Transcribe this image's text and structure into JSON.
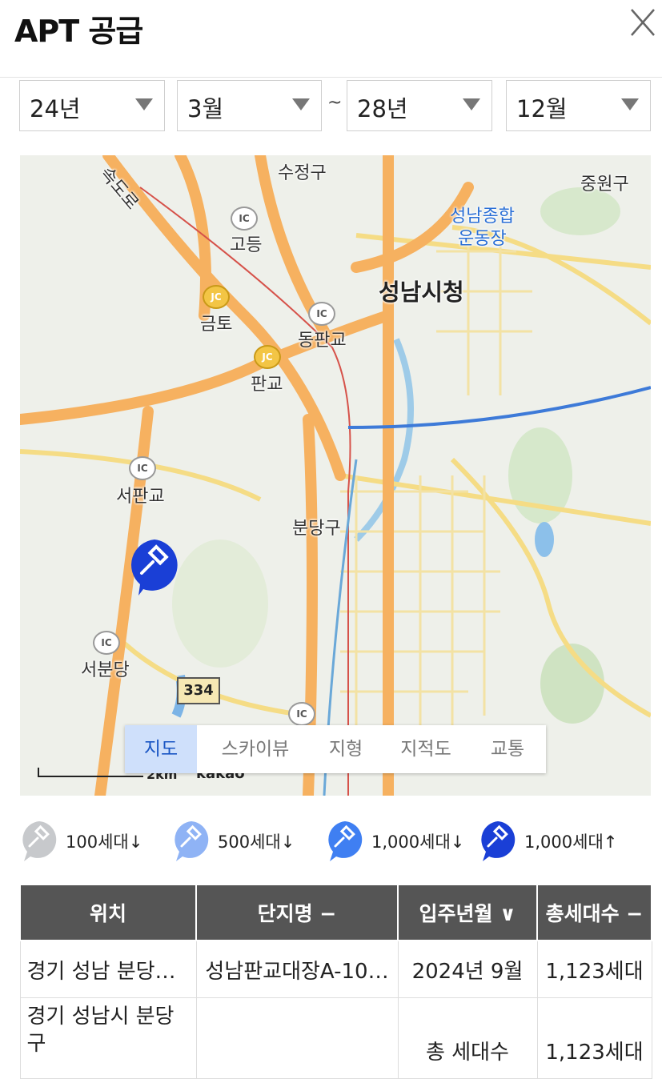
{
  "header": {
    "title": "APT 공급",
    "close_icon": "close-icon"
  },
  "filters": {
    "from_year": "24년",
    "from_month": "3월",
    "separator": "~",
    "to_year": "28년",
    "to_month": "12월"
  },
  "map": {
    "labels": {
      "sujeong": "수정구",
      "jungwon": "중원구",
      "sports1": "성남종합",
      "sports2": "운동장",
      "cityhall": "성남시청",
      "godeung": "고등",
      "geumto": "금토",
      "dongpangyo": "동판교",
      "pangyo": "판교",
      "seopangyo": "서판교",
      "bundang": "분당구",
      "seobundang": "서분당",
      "expressway": "속도로"
    },
    "ic": "IC",
    "jc": "JC",
    "route": "334",
    "scale": "2km",
    "brand": "kakao",
    "types": [
      "지도",
      "스카이뷰",
      "지형",
      "지적도",
      "교통"
    ],
    "active_type": "지도"
  },
  "legend": [
    {
      "label": "100세대↓",
      "color": "#c7c9cc"
    },
    {
      "label": "500세대↓",
      "color": "#8fb3f5"
    },
    {
      "label": "1,000세대↓",
      "color": "#3f7ff2"
    },
    {
      "label": "1,000세대↑",
      "color": "#1a3fd6"
    }
  ],
  "table": {
    "headers": [
      "위치",
      "단지명 −",
      "입주년월 ∨",
      "총세대수 −"
    ],
    "rows": [
      [
        "경기 성남 분당…",
        "성남판교대장A-10…",
        "2024년 9월",
        "1,123세대"
      ],
      [
        "경기 성남시 분당구",
        "",
        "총 세대수",
        "1,123세대"
      ]
    ]
  }
}
